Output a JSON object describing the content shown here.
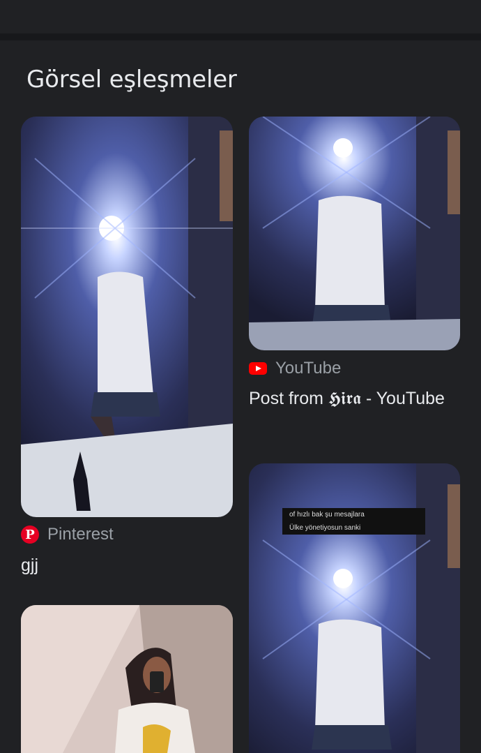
{
  "section": {
    "title": "Görsel eşleşmeler"
  },
  "results": [
    {
      "source": "Pinterest",
      "source_icon": "pinterest-icon",
      "title": "gjj"
    },
    {
      "source": "YouTube",
      "source_icon": "youtube-icon",
      "title": "Post from 𝕳𝖎𝖗𝖆 - YouTube"
    },
    {
      "overlay_lines": [
        "of hızlı bak şu mesajlara",
        "Ülke yönetiyosun sanki"
      ]
    }
  ],
  "colors": {
    "background": "#202124",
    "text": "#e8eaed",
    "secondary_text": "#9aa0a6",
    "youtube": "#ff0000",
    "pinterest": "#e60023"
  }
}
